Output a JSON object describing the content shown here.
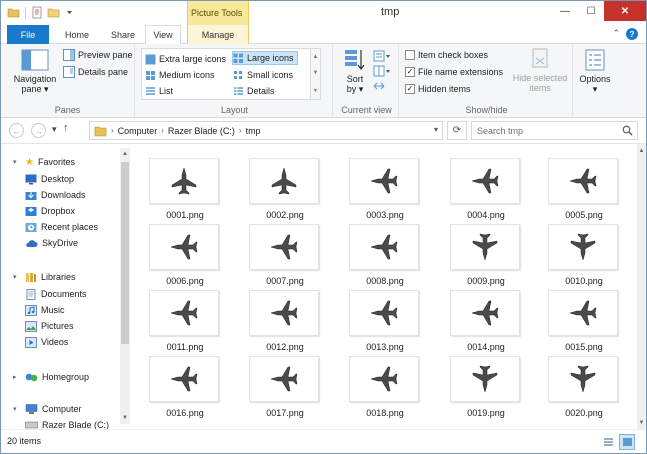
{
  "window": {
    "title": "tmp",
    "picture_tools_label": "Picture Tools",
    "controls": {
      "minimize": "—",
      "maximize": "☐",
      "close": "✕"
    }
  },
  "tabs": {
    "file": "File",
    "home": "Home",
    "share": "Share",
    "view": "View",
    "manage": "Manage",
    "help": "?"
  },
  "ribbon": {
    "panes": {
      "label": "Panes",
      "navigation_pane": "Navigation\npane ▾",
      "preview_pane": "Preview pane",
      "details_pane": "Details pane"
    },
    "layout": {
      "label": "Layout",
      "extra_large_icons": "Extra large icons",
      "large_icons": "Large icons",
      "medium_icons": "Medium icons",
      "small_icons": "Small icons",
      "list": "List",
      "details": "Details"
    },
    "current_view": {
      "label": "Current view",
      "sort_by": "Sort\nby ▾"
    },
    "show_hide": {
      "label": "Show/hide",
      "item_check_boxes": "Item check boxes",
      "file_name_extensions": "File name extensions",
      "hidden_items": "Hidden items",
      "hide_selected_items": "Hide selected\nitems",
      "item_check_boxes_checked": false,
      "file_name_extensions_checked": true,
      "hidden_items_checked": true
    },
    "options": "Options\n▾"
  },
  "address": {
    "crumbs": [
      "Computer",
      "Razer Blade (C:)",
      "tmp"
    ],
    "search_placeholder": "Search tmp"
  },
  "nav": {
    "favorites_header": "Favorites",
    "favorites": [
      "Desktop",
      "Downloads",
      "Dropbox",
      "Recent places",
      "SkyDrive"
    ],
    "libraries_header": "Libraries",
    "libraries": [
      "Documents",
      "Music",
      "Pictures",
      "Videos"
    ],
    "homegroup": "Homegroup",
    "computer": "Computer",
    "drive": "Razer Blade (C:)"
  },
  "files": [
    "0001.png",
    "0002.png",
    "0003.png",
    "0004.png",
    "0005.png",
    "0006.png",
    "0007.png",
    "0008.png",
    "0009.png",
    "0010.png",
    "0011.png",
    "0012.png",
    "0013.png",
    "0014.png",
    "0015.png",
    "0016.png",
    "0017.png",
    "0018.png",
    "0019.png",
    "0020.png"
  ],
  "status": {
    "item_count": "20 items"
  },
  "colors": {
    "file_tab": "#1979ca",
    "picture_tools": "#f8e99a",
    "close_button": "#c7312b",
    "selection": "#cce4f7"
  }
}
